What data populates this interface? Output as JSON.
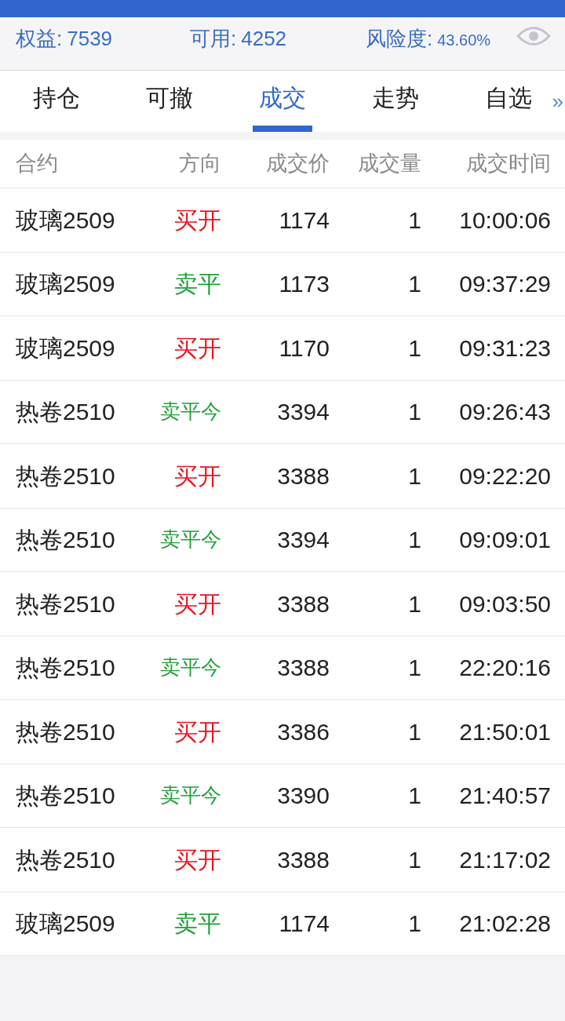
{
  "summary": [
    {
      "label": "权益:",
      "value": "7539"
    },
    {
      "label": "可用:",
      "value": "4252"
    },
    {
      "label": "风险度:",
      "value": "43.60%"
    }
  ],
  "tabs": [
    {
      "label": "持仓",
      "selected": false
    },
    {
      "label": "可撤",
      "selected": false
    },
    {
      "label": "成交",
      "selected": true
    },
    {
      "label": "走势",
      "selected": false
    },
    {
      "label": "自选",
      "selected": false
    }
  ],
  "more_tabs": "»",
  "table": {
    "columns": [
      "合约",
      "方向",
      "成交价",
      "成交量",
      "成交时间"
    ],
    "rows": [
      {
        "contract": "玻璃2509",
        "direction": "买开",
        "color": "#e8141c",
        "price": "1174",
        "volume": "1",
        "time": "10:00:06"
      },
      {
        "contract": "玻璃2509",
        "direction": "卖平",
        "color": "#22a03c",
        "price": "1173",
        "volume": "1",
        "time": "09:37:29"
      },
      {
        "contract": "玻璃2509",
        "direction": "买开",
        "color": "#e8141c",
        "price": "1170",
        "volume": "1",
        "time": "09:31:23"
      },
      {
        "contract": "热卷2510",
        "direction": "卖平今",
        "color": "#22a03c",
        "price": "3394",
        "volume": "1",
        "time": "09:26:43"
      },
      {
        "contract": "热卷2510",
        "direction": "买开",
        "color": "#e8141c",
        "price": "3388",
        "volume": "1",
        "time": "09:22:20"
      },
      {
        "contract": "热卷2510",
        "direction": "卖平今",
        "color": "#22a03c",
        "price": "3394",
        "volume": "1",
        "time": "09:09:01"
      },
      {
        "contract": "热卷2510",
        "direction": "买开",
        "color": "#e8141c",
        "price": "3388",
        "volume": "1",
        "time": "09:03:50"
      },
      {
        "contract": "热卷2510",
        "direction": "卖平今",
        "color": "#22a03c",
        "price": "3388",
        "volume": "1",
        "time": "22:20:16"
      },
      {
        "contract": "热卷2510",
        "direction": "买开",
        "color": "#e8141c",
        "price": "3386",
        "volume": "1",
        "time": "21:50:01"
      },
      {
        "contract": "热卷2510",
        "direction": "卖平今",
        "color": "#22a03c",
        "price": "3390",
        "volume": "1",
        "time": "21:40:57"
      },
      {
        "contract": "热卷2510",
        "direction": "买开",
        "color": "#e8141c",
        "price": "3388",
        "volume": "1",
        "time": "21:17:02"
      },
      {
        "contract": "玻璃2509",
        "direction": "卖平",
        "color": "#22a03c",
        "price": "1174",
        "volume": "1",
        "time": "21:02:28"
      }
    ]
  }
}
